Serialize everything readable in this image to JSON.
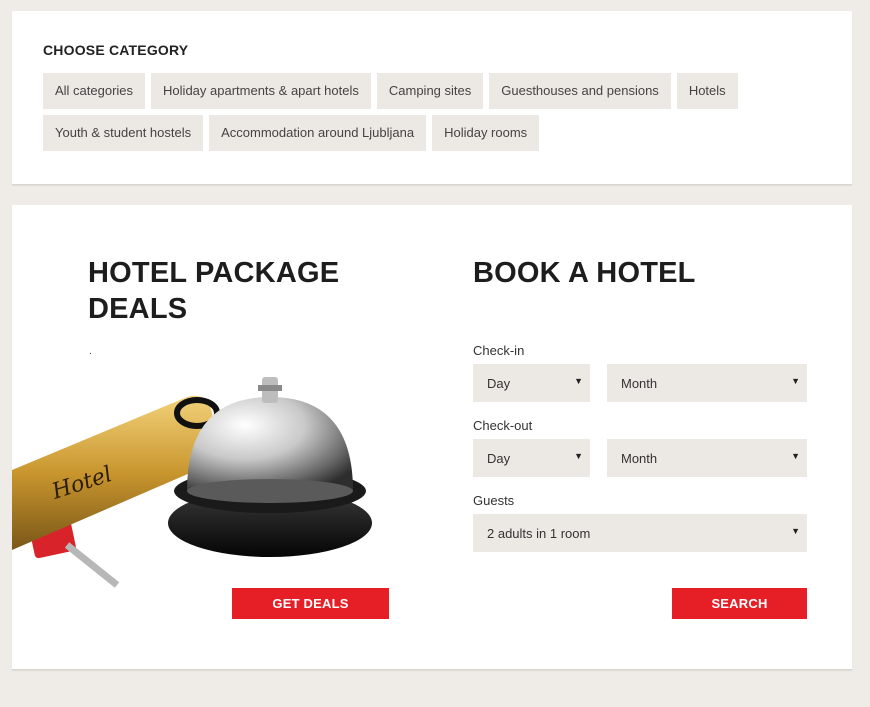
{
  "categories": {
    "title": "CHOOSE CATEGORY",
    "row1": [
      "All categories",
      "Holiday apartments & apart hotels",
      "Camping sites",
      "Guesthouses and pensions",
      "Hotels"
    ],
    "row2": [
      "Youth & student hostels",
      "Accommodation around Ljubljana",
      "Holiday rooms"
    ]
  },
  "deals": {
    "title": "HOTEL PACKAGE DEALS",
    "note": ".",
    "image_text": "Hotel",
    "button_label": "GET DEALS"
  },
  "booking": {
    "title": "BOOK A HOTEL",
    "checkin_label": "Check-in",
    "checkout_label": "Check-out",
    "guests_label": "Guests",
    "checkin_day": "Day",
    "checkin_month": "Month",
    "checkout_day": "Day",
    "checkout_month": "Month",
    "guests_value": "2 adults in 1 room",
    "dropdown_icon": "caret-down-icon",
    "search_label": "SEARCH"
  },
  "colors": {
    "accent": "#e61e25",
    "page_bg": "#efece7",
    "chip_bg": "#ece9e4"
  }
}
